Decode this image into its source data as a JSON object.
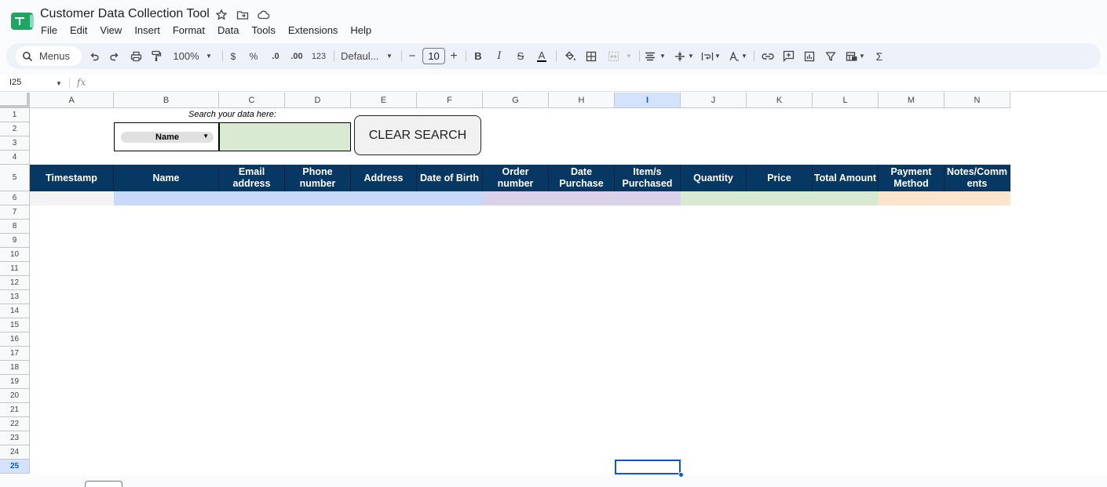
{
  "app": {
    "title": "Customer Data Collection Tool",
    "menus": [
      "File",
      "Edit",
      "View",
      "Insert",
      "Format",
      "Data",
      "Tools",
      "Extensions",
      "Help"
    ]
  },
  "toolbar": {
    "search_label": "Menus",
    "zoom": "100%",
    "currency": "$",
    "percent": "%",
    "decrease_decimal": ".0",
    "increase_decimal": ".00",
    "number_format": "123",
    "font": "Defaul...",
    "font_size": "10",
    "minus": "−",
    "plus": "+",
    "bold": "B",
    "italic": "I",
    "strike": "S",
    "text_color": "A",
    "sigma": "Σ"
  },
  "formula_bar": {
    "cell_ref": "I25",
    "fx": "fx",
    "value": ""
  },
  "grid": {
    "columns": [
      "A",
      "B",
      "C",
      "D",
      "E",
      "F",
      "G",
      "H",
      "I",
      "J",
      "K",
      "L",
      "M",
      "N"
    ],
    "selected_column": "I",
    "rows": [
      "1",
      "2",
      "3",
      "4",
      "5",
      "6",
      "7",
      "8",
      "9",
      "10",
      "11",
      "12",
      "13",
      "14",
      "15",
      "16",
      "17",
      "18",
      "19",
      "20",
      "21",
      "22",
      "23",
      "24",
      "25"
    ],
    "selected_row": "25"
  },
  "search_panel": {
    "label": "Search your data here:",
    "dropdown_value": "Name",
    "search_value": "",
    "clear_button": "CLEAR SEARCH"
  },
  "table_headers": [
    "Timestamp",
    "Name",
    "Email address",
    "Phone number",
    "Address",
    "Date of Birth",
    "Order number",
    "Date Purchase",
    "Item/s Purchased",
    "Quantity",
    "Price",
    "Total Amount",
    "Payment Method",
    "Notes/Comm ents"
  ],
  "colors": {
    "header_bg": "#073763",
    "header_text": "#ffffff",
    "band_timestamp": "#f3f3f3",
    "band_contact": "#c9daf8",
    "band_order": "#d9d2e9",
    "band_amount": "#d9ead3",
    "band_payment": "#fce5cd",
    "search_input_bg": "#d9ead3",
    "selection": "#0b57d0"
  }
}
